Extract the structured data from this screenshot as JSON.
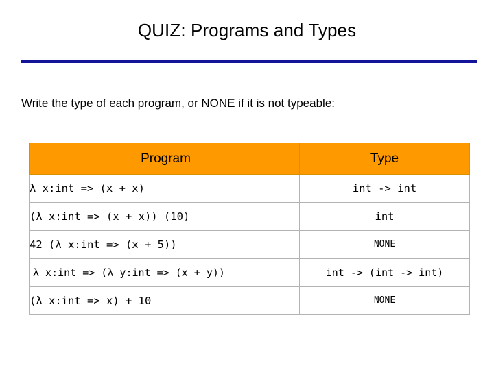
{
  "slide": {
    "title": "QUIZ: Programs and Types",
    "rule_color": "#14149b",
    "prompt": "Write the type of each program, or NONE if it is not typeable:"
  },
  "table": {
    "header_background": "#ff9900",
    "columns": [
      "Program",
      "Type"
    ],
    "rows": [
      {
        "program": "λ x:int => (x + x)",
        "type": "int -> int"
      },
      {
        "program": "(λ x:int => (x + x)) (10)",
        "type": "int"
      },
      {
        "program": "42 (λ x:int => (x + 5))",
        "type": "NONE"
      },
      {
        "program": "λ x:int => (λ y:int => (x + y))",
        "type": "int -> (int -> int)"
      },
      {
        "program": "(λ x:int => x) + 10",
        "type": "NONE"
      }
    ]
  }
}
